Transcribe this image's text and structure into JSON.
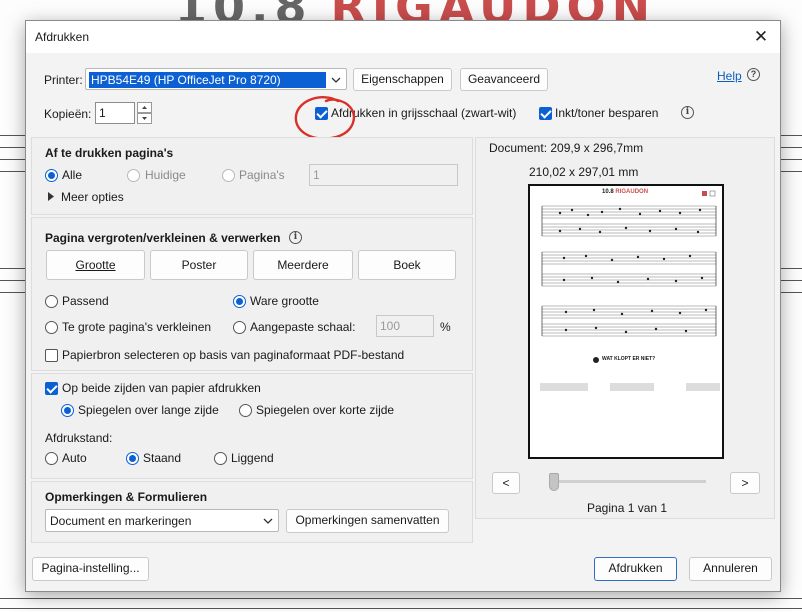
{
  "background": {
    "title_number": "10.8",
    "title_word": "RIGAUDON"
  },
  "dialog": {
    "title": "Afdrukken",
    "close_glyph": "✕"
  },
  "printer": {
    "label": "Printer:",
    "selected": "HPB54E49 (HP OfficeJet Pro 8720)",
    "properties_button": "Eigenschappen",
    "advanced_button": "Geavanceerd",
    "help_link": "Help",
    "help_icon": "?"
  },
  "copies": {
    "label": "Kopieën:",
    "value": "1"
  },
  "options": {
    "grayscale_label": "Afdrukken in grijsschaal (zwart-wit)",
    "grayscale_checked": true,
    "save_ink_label": "Inkt/toner besparen",
    "save_ink_checked": true
  },
  "pages_to_print": {
    "title": "Af te drukken pagina's",
    "all": "Alle",
    "current": "Huidige",
    "pages": "Pagina's",
    "pages_value": "1",
    "more_options": "Meer opties",
    "selected": "all"
  },
  "sizing": {
    "title": "Pagina vergroten/verkleinen & verwerken",
    "tabs": [
      "Grootte",
      "Poster",
      "Meerdere",
      "Boek"
    ],
    "fit": "Passend",
    "actual_size": "Ware grootte",
    "shrink_oversized": "Te grote pagina's verkleinen",
    "custom_scale": "Aangepaste schaal:",
    "custom_scale_value": "100",
    "percent": "%",
    "selected": "actual_size",
    "paper_source_label": "Papierbron selecteren op basis van paginaformaat PDF-bestand",
    "paper_source_checked": false
  },
  "duplex": {
    "label": "Op beide zijden van papier afdrukken",
    "checked": true,
    "long_edge": "Spiegelen over lange zijde",
    "short_edge": "Spiegelen over korte zijde",
    "selected": "long_edge"
  },
  "orientation": {
    "label": "Afdrukstand:",
    "auto": "Auto",
    "portrait": "Staand",
    "landscape": "Liggend",
    "selected": "portrait"
  },
  "comments": {
    "title": "Opmerkingen & Formulieren",
    "selected": "Document en markeringen",
    "summarize_button": "Opmerkingen samenvatten"
  },
  "preview": {
    "document_size": "Document: 209,9 x 296,7mm",
    "paper_size": "210,02 x 297,01 mm",
    "prev_button": "<",
    "next_button": ">",
    "page_indicator": "Pagina 1 van 1",
    "page_title_num": "10.8",
    "page_title_word": "RIGAUDON",
    "question": "WAT KLOPT ER NIET?",
    "slider_fraction": 0
  },
  "footer": {
    "page_setup_button": "Pagina-instelling...",
    "print_button": "Afdrukken",
    "cancel_button": "Annuleren"
  },
  "colors": {
    "accent": "#0b60d3",
    "annotation": "#d9302a",
    "title_red": "#c94d4d"
  }
}
